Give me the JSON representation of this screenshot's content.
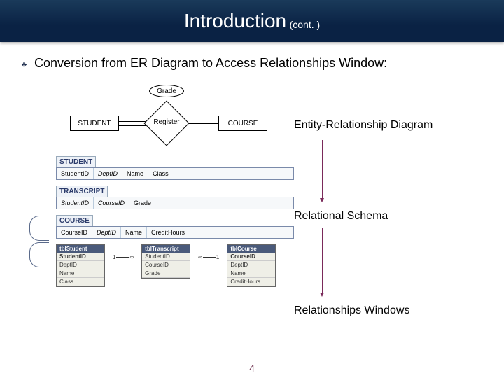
{
  "header": {
    "title": "Introduction",
    "subtitle": "(cont. )"
  },
  "bullet": {
    "icon": "❖",
    "text": "Conversion from ER Diagram to Access Relationships Window:"
  },
  "er": {
    "attribute": "Grade",
    "entity1": "STUDENT",
    "relation": "Register",
    "entity2": "COURSE"
  },
  "schema": {
    "student": {
      "name": "STUDENT",
      "cols": [
        "StudentID",
        "DeptID",
        "Name",
        "Class"
      ]
    },
    "transcript": {
      "name": "TRANSCRIPT",
      "cols": [
        "StudentID",
        "CourseID",
        "Grade"
      ]
    },
    "course": {
      "name": "COURSE",
      "cols": [
        "CourseID",
        "DeptID",
        "Name",
        "CreditHours"
      ]
    }
  },
  "access": {
    "t1": {
      "name": "tblStudent",
      "fields": [
        "StudentID",
        "DeptID",
        "Name",
        "Class"
      ]
    },
    "t2": {
      "name": "tblTranscript",
      "fields": [
        "StudentID",
        "CourseID",
        "Grade"
      ]
    },
    "t3": {
      "name": "tblCourse",
      "fields": [
        "CourseID",
        "DeptID",
        "Name",
        "CreditHours"
      ]
    },
    "left": {
      "one": "1",
      "many": "∞"
    },
    "right": {
      "one": "1",
      "many": "∞"
    }
  },
  "labels": {
    "er": "Entity-Relationship Diagram",
    "rs": "Relational Schema",
    "rw": "Relationships Windows"
  },
  "page": "4"
}
